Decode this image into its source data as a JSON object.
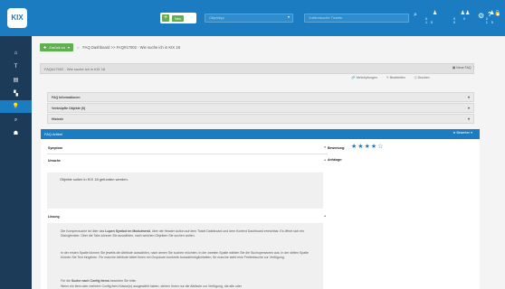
{
  "header": {
    "logo": "KIX",
    "new_label": "Neu",
    "type_select_placeholder": "Objekttyp",
    "search_placeholder": "Volltextsuche Tickets",
    "stats": [
      {
        "icon": "ticket-total-icon",
        "count": "0 15"
      },
      {
        "icon": "escalation-icon",
        "count": "0 0 0"
      },
      {
        "icon": "reminder-icon",
        "count": "0 15"
      }
    ]
  },
  "breadcrumb": {
    "back_label": "Zurück zu",
    "path": "FAQ Dashboard >> FAQ#17002 - Wie suche ich in KIX 18"
  },
  "faq": {
    "title": "FAQ#17002 - Wie suche ich in KIX 18",
    "new_faq": "Neue FAQ",
    "actions": [
      "Verknüpfungen",
      "Bearbeiten",
      "Drucken"
    ],
    "accordions": [
      "FAQ Informationen",
      "Verknüpfte Objekte (0)",
      "Historie"
    ],
    "article_header": "FAQ Artikel",
    "bewerten": "Bewerten",
    "sections": {
      "symptom": "Symptom",
      "ursache": "Ursache",
      "ursache_text": "Objekte sollen in KIX 18 gefunden werden.",
      "loesung": "Lösung",
      "loesung_p1_start": "Die Komplexsuche ist über das ",
      "loesung_p1_bold": "Lupen Symbol im Modulmenü",
      "loesung_p1_end": ", über die Header Action auf dem Ticket Dashboard und dem Kontext Dashboard erreichbar. Es öffnet sich ein Dialogfenster. Über die Tabs können Sie auswählen, nach welchen Objekten Sie suchen wollen.",
      "loesung_p2": "In der ersten Spalte können Sie jeweils die Attribute auswählen, nach denen Sie suchen möchten. In der zweiten Spalte wählen Sie die Suchoperatoren aus. In der dritten Spalte können Sie Text eingeben. Für manche Attribute bietet Ihnen ein Dropdown konkrete Auswahlmöglichkeiten, für manche steht eine Freitextsuche zur Verfügung.",
      "loesung_p3_start": "Für die ",
      "loesung_p3_bold": "Suche nach Config Items",
      "loesung_p3_end": " beachten Sie bitte:",
      "loesung_p4": "Wenn ein Item oder mehrere Config Item Klasse(n) ausgewählt haben, stehen Ihnen nur die Attribute zur Verfügung, die alle oder"
    },
    "rating_label": "Bewertung:",
    "rating": 4,
    "rating_max": 5,
    "attachments_label": "Anhänge:"
  },
  "colors": {
    "primary": "#1c7cc1",
    "sidebar": "#1b3b58",
    "accent_green": "#61b04f"
  }
}
